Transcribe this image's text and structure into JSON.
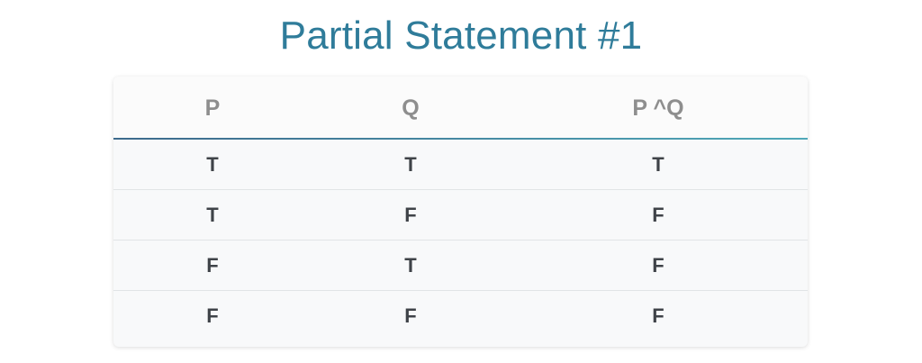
{
  "title": "Partial Statement #1",
  "table": {
    "headers": [
      "P",
      "Q",
      "P ^Q"
    ],
    "rows": [
      [
        "T",
        "T",
        "T"
      ],
      [
        "T",
        "F",
        "F"
      ],
      [
        "F",
        "T",
        "F"
      ],
      [
        "F",
        "F",
        "F"
      ]
    ]
  },
  "colors": {
    "title": "#2f7c9a",
    "header_text": "#8e8e8e",
    "cell_text": "#3f4348",
    "header_rule_start": "#3d6a8c",
    "header_rule_end": "#4fa8b8"
  }
}
